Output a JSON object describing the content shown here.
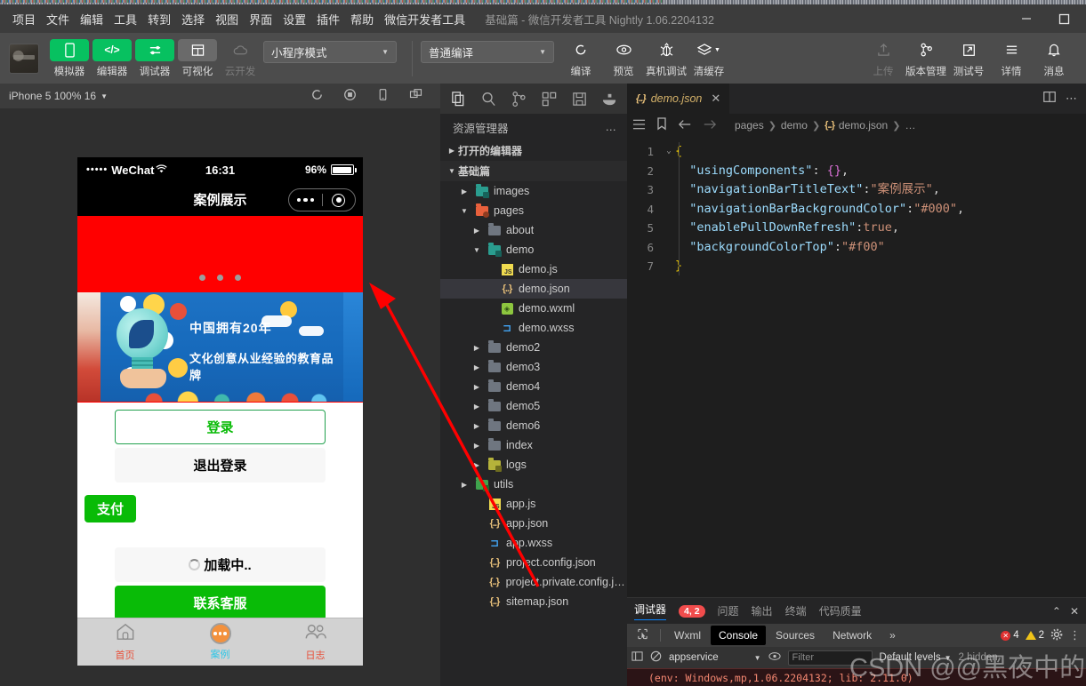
{
  "window": {
    "title": "基础篇 - 微信开发者工具 Nightly 1.06.2204132",
    "minimize": "–",
    "maximize": "□"
  },
  "menubar": {
    "items": [
      "项目",
      "文件",
      "编辑",
      "工具",
      "转到",
      "选择",
      "视图",
      "界面",
      "设置",
      "插件",
      "帮助",
      "微信开发者工具"
    ]
  },
  "toolbar": {
    "buttons": [
      {
        "label": "模拟器",
        "icon": "phone-icon",
        "style": "green"
      },
      {
        "label": "编辑器",
        "icon": "code-icon",
        "style": "green"
      },
      {
        "label": "调试器",
        "icon": "debug-icon",
        "style": "green"
      },
      {
        "label": "可视化",
        "icon": "layout-icon",
        "style": "grey"
      },
      {
        "label": "云开发",
        "icon": "cloud-icon",
        "style": "disabled"
      }
    ],
    "mode_select": "小程序模式",
    "compile_select": "普通编译",
    "actions": [
      {
        "label": "编译",
        "icon": "refresh-icon"
      },
      {
        "label": "预览",
        "icon": "eye-icon"
      },
      {
        "label": "真机调试",
        "icon": "bug-icon"
      },
      {
        "label": "清缓存",
        "icon": "layers-icon"
      }
    ],
    "right_actions": [
      {
        "label": "上传",
        "icon": "upload-icon",
        "disabled": true
      },
      {
        "label": "版本管理",
        "icon": "git-branch-icon",
        "disabled": false
      },
      {
        "label": "测试号",
        "icon": "external-link-icon",
        "disabled": false
      },
      {
        "label": "详情",
        "icon": "menu-icon",
        "disabled": false
      },
      {
        "label": "消息",
        "icon": "bell-icon",
        "disabled": false
      }
    ]
  },
  "simulator": {
    "device_label": "iPhone 5 100% 16",
    "toolbar_icons": [
      "rotate-icon",
      "record-icon",
      "device-icon",
      "windows-icon"
    ],
    "phone": {
      "status": {
        "carrier": "WeChat",
        "dots": "•••••",
        "wifi": "wifi-icon",
        "time": "16:31",
        "battery_pct": "96%"
      },
      "nav_title": "案例展示",
      "swiper_dot_count": 3,
      "banner_text_line1": "中国拥有20年",
      "banner_text_line2": "文化创意从业经验的教育品牌",
      "buttons": [
        {
          "label": "登录",
          "style": "outline"
        },
        {
          "label": "退出登录",
          "style": "plain"
        },
        {
          "label": "支付",
          "style": "pay"
        },
        {
          "label": "加载中..",
          "style": "loading"
        },
        {
          "label": "联系客服",
          "style": "primary"
        }
      ],
      "tabbar": [
        {
          "label": "首页",
          "icon": "home-icon",
          "color": "#e8503a",
          "active": false
        },
        {
          "label": "案例",
          "icon": "dots-circle-icon",
          "color": "#2dc7e8",
          "active": true
        },
        {
          "label": "日志",
          "icon": "group-icon",
          "color": "#e8503a",
          "active": false
        }
      ]
    }
  },
  "explorer": {
    "activity_icons": [
      "files-icon",
      "search-icon",
      "source-control-icon",
      "extensions-icon",
      "save-icon",
      "docker-icon"
    ],
    "title": "资源管理器",
    "more": "…",
    "sections": [
      {
        "label": "打开的编辑器",
        "expanded": false
      },
      {
        "label": "基础篇",
        "expanded": true
      }
    ],
    "tree": [
      {
        "name": "images",
        "type": "folder-images",
        "depth": 1,
        "expanded": false,
        "color": "#2a9d8f"
      },
      {
        "name": "pages",
        "type": "folder-pages",
        "depth": 1,
        "expanded": true,
        "color": "#e8603c"
      },
      {
        "name": "about",
        "type": "folder",
        "depth": 2,
        "expanded": false,
        "color": "#6f7680"
      },
      {
        "name": "demo",
        "type": "folder-images",
        "depth": 2,
        "expanded": true,
        "color": "#2a9d8f"
      },
      {
        "name": "demo.js",
        "type": "js",
        "depth": 3
      },
      {
        "name": "demo.json",
        "type": "json",
        "depth": 3,
        "selected": true
      },
      {
        "name": "demo.wxml",
        "type": "wxml",
        "depth": 3
      },
      {
        "name": "demo.wxss",
        "type": "wxss",
        "depth": 3
      },
      {
        "name": "demo2",
        "type": "folder",
        "depth": 2,
        "expanded": false,
        "color": "#6f7680"
      },
      {
        "name": "demo3",
        "type": "folder",
        "depth": 2,
        "expanded": false,
        "color": "#6f7680"
      },
      {
        "name": "demo4",
        "type": "folder",
        "depth": 2,
        "expanded": false,
        "color": "#6f7680"
      },
      {
        "name": "demo5",
        "type": "folder",
        "depth": 2,
        "expanded": false,
        "color": "#6f7680"
      },
      {
        "name": "demo6",
        "type": "folder",
        "depth": 2,
        "expanded": false,
        "color": "#6f7680"
      },
      {
        "name": "index",
        "type": "folder",
        "depth": 2,
        "expanded": false,
        "color": "#6f7680"
      },
      {
        "name": "logs",
        "type": "folder-logs",
        "depth": 2,
        "expanded": false,
        "color": "#b5b23a"
      },
      {
        "name": "utils",
        "type": "folder-utils",
        "depth": 1,
        "expanded": false,
        "color": "#3fa34d"
      },
      {
        "name": "app.js",
        "type": "js",
        "depth": 2
      },
      {
        "name": "app.json",
        "type": "json",
        "depth": 2
      },
      {
        "name": "app.wxss",
        "type": "wxss",
        "depth": 2
      },
      {
        "name": "project.config.json",
        "type": "json",
        "depth": 2
      },
      {
        "name": "project.private.config.js…",
        "type": "json",
        "depth": 2
      },
      {
        "name": "sitemap.json",
        "type": "json",
        "depth": 2
      }
    ]
  },
  "editor": {
    "tab": {
      "label": "demo.json",
      "icon": "json-icon",
      "close": "✕"
    },
    "split_icon": "split-editor-icon",
    "more_icon": "more-icon",
    "breadcrumb_icons": [
      "outline-icon",
      "bookmark-icon",
      "back-arrow-icon",
      "forward-arrow-icon"
    ],
    "breadcrumb": [
      "pages",
      "demo",
      "demo.json",
      "…"
    ],
    "lines": [
      {
        "n": "1",
        "fold": "⌄",
        "tokens": [
          {
            "t": "{",
            "c": "c-brace"
          }
        ]
      },
      {
        "n": "2",
        "fold": "",
        "tokens": [
          {
            "t": "  ",
            "c": "c-punct"
          },
          {
            "t": "\"usingComponents\"",
            "c": "c-key"
          },
          {
            "t": ": ",
            "c": "c-punct"
          },
          {
            "t": "{}",
            "c": "c-pink"
          },
          {
            "t": ",",
            "c": "c-punct"
          }
        ]
      },
      {
        "n": "3",
        "fold": "",
        "tokens": [
          {
            "t": "  ",
            "c": "c-punct"
          },
          {
            "t": "\"navigationBarTitleText\"",
            "c": "c-key"
          },
          {
            "t": ":",
            "c": "c-punct"
          },
          {
            "t": "\"案例展示\"",
            "c": "c-str"
          },
          {
            "t": ",",
            "c": "c-punct"
          }
        ]
      },
      {
        "n": "4",
        "fold": "",
        "tokens": [
          {
            "t": "  ",
            "c": "c-punct"
          },
          {
            "t": "\"navigationBarBackgroundColor\"",
            "c": "c-key"
          },
          {
            "t": ":",
            "c": "c-punct"
          },
          {
            "t": "\"#000\"",
            "c": "c-str"
          },
          {
            "t": ",",
            "c": "c-punct"
          }
        ]
      },
      {
        "n": "5",
        "fold": "",
        "tokens": [
          {
            "t": "  ",
            "c": "c-punct"
          },
          {
            "t": "\"enablePullDownRefresh\"",
            "c": "c-key"
          },
          {
            "t": ":",
            "c": "c-punct"
          },
          {
            "t": "true",
            "c": "c-bool"
          },
          {
            "t": ",",
            "c": "c-punct"
          }
        ]
      },
      {
        "n": "6",
        "fold": "",
        "tokens": [
          {
            "t": "  ",
            "c": "c-punct"
          },
          {
            "t": "\"backgroundColorTop\"",
            "c": "c-key"
          },
          {
            "t": ":",
            "c": "c-punct"
          },
          {
            "t": "\"#f00\"",
            "c": "c-str"
          }
        ]
      },
      {
        "n": "7",
        "fold": "",
        "tokens": [
          {
            "t": "}",
            "c": "c-brace"
          }
        ]
      }
    ]
  },
  "console": {
    "panel_tabs": [
      {
        "label": "调试器",
        "active": true,
        "badge": "4, 2"
      },
      {
        "label": "问题",
        "active": false
      },
      {
        "label": "输出",
        "active": false
      },
      {
        "label": "终端",
        "active": false
      },
      {
        "label": "代码质量",
        "active": false
      }
    ],
    "collapse_icon": "chevron-up-icon",
    "close_icon": "close-icon",
    "devtools_tabs": [
      {
        "label": "Wxml",
        "active": false
      },
      {
        "label": "Console",
        "active": true
      },
      {
        "label": "Sources",
        "active": false
      },
      {
        "label": "Network",
        "active": false
      }
    ],
    "overflow": "»",
    "inspect_icon": "inspect-icon",
    "error_count": "4",
    "warning_count": "2",
    "gear_icon": "gear-icon",
    "kebab_icon": "more-vertical-icon",
    "filter_toolbar": {
      "sidebar_icon": "sidebar-icon",
      "clear_icon": "clear-icon",
      "context": "appservice",
      "eye_icon": "eye-icon",
      "filter_placeholder": "Filter",
      "levels": "Default levels",
      "hidden": "2 hidden"
    },
    "log_line": "(env: Windows,mp,1.06.2204132; lib: 2.11.0)"
  },
  "watermark": "CSDN @@黑夜中的一盏明灯",
  "colors": {
    "accent_green": "#07c160",
    "mp_green": "#09bb07",
    "red_band": "#ff0000",
    "error_red": "#f14c4c",
    "tab_orange": "#f3913d"
  }
}
